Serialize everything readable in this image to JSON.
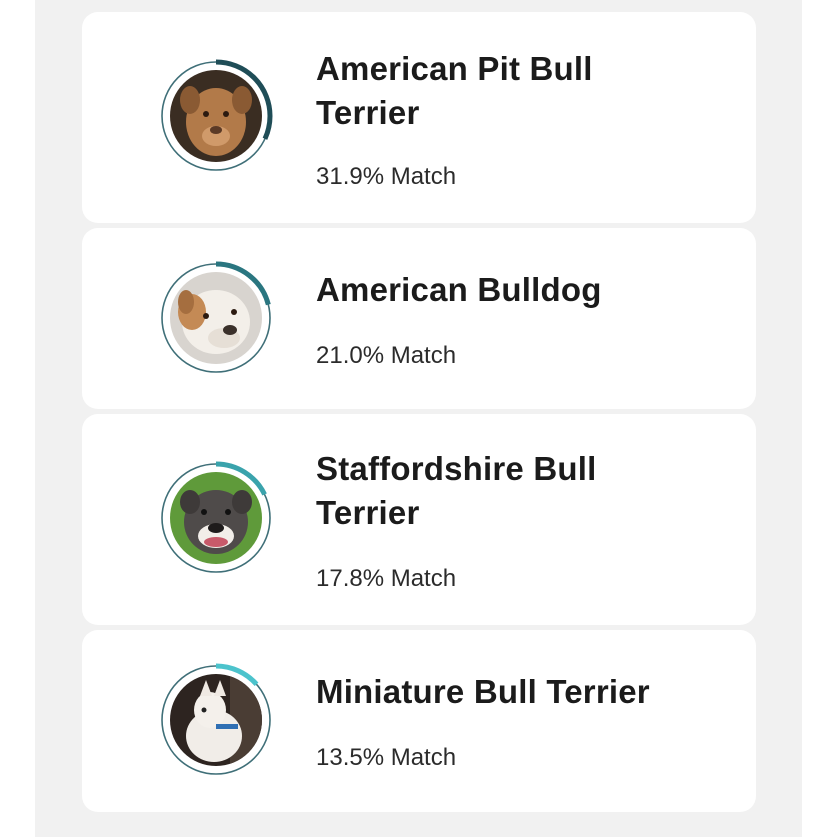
{
  "ring_colors": {
    "track": "#3f6f78",
    "progress_1": "#1f4d57",
    "progress_2": "#2a7680",
    "progress_3": "#3aa3ac",
    "progress_4": "#4cc3cc"
  },
  "results": [
    {
      "breed": "American Pit Bull Terrier",
      "breed_line1": "American Pit Bull",
      "breed_line2": "Terrier",
      "match": "31.9% Match",
      "match_fraction": 0.319,
      "icon": "pit-bull-photo"
    },
    {
      "breed": "American Bulldog",
      "breed_line1": "American Bulldog",
      "breed_line2": "",
      "match": "21.0% Match",
      "match_fraction": 0.21,
      "icon": "bulldog-photo"
    },
    {
      "breed": "Staffordshire Bull Terrier",
      "breed_line1": "Staffordshire Bull",
      "breed_line2": "Terrier",
      "match": "17.8% Match",
      "match_fraction": 0.178,
      "icon": "staffordshire-photo"
    },
    {
      "breed": "Miniature Bull Terrier",
      "breed_line1": "Miniature Bull Terrier",
      "breed_line2": "",
      "match": "13.5% Match",
      "match_fraction": 0.135,
      "icon": "mini-bull-terrier-photo"
    }
  ]
}
